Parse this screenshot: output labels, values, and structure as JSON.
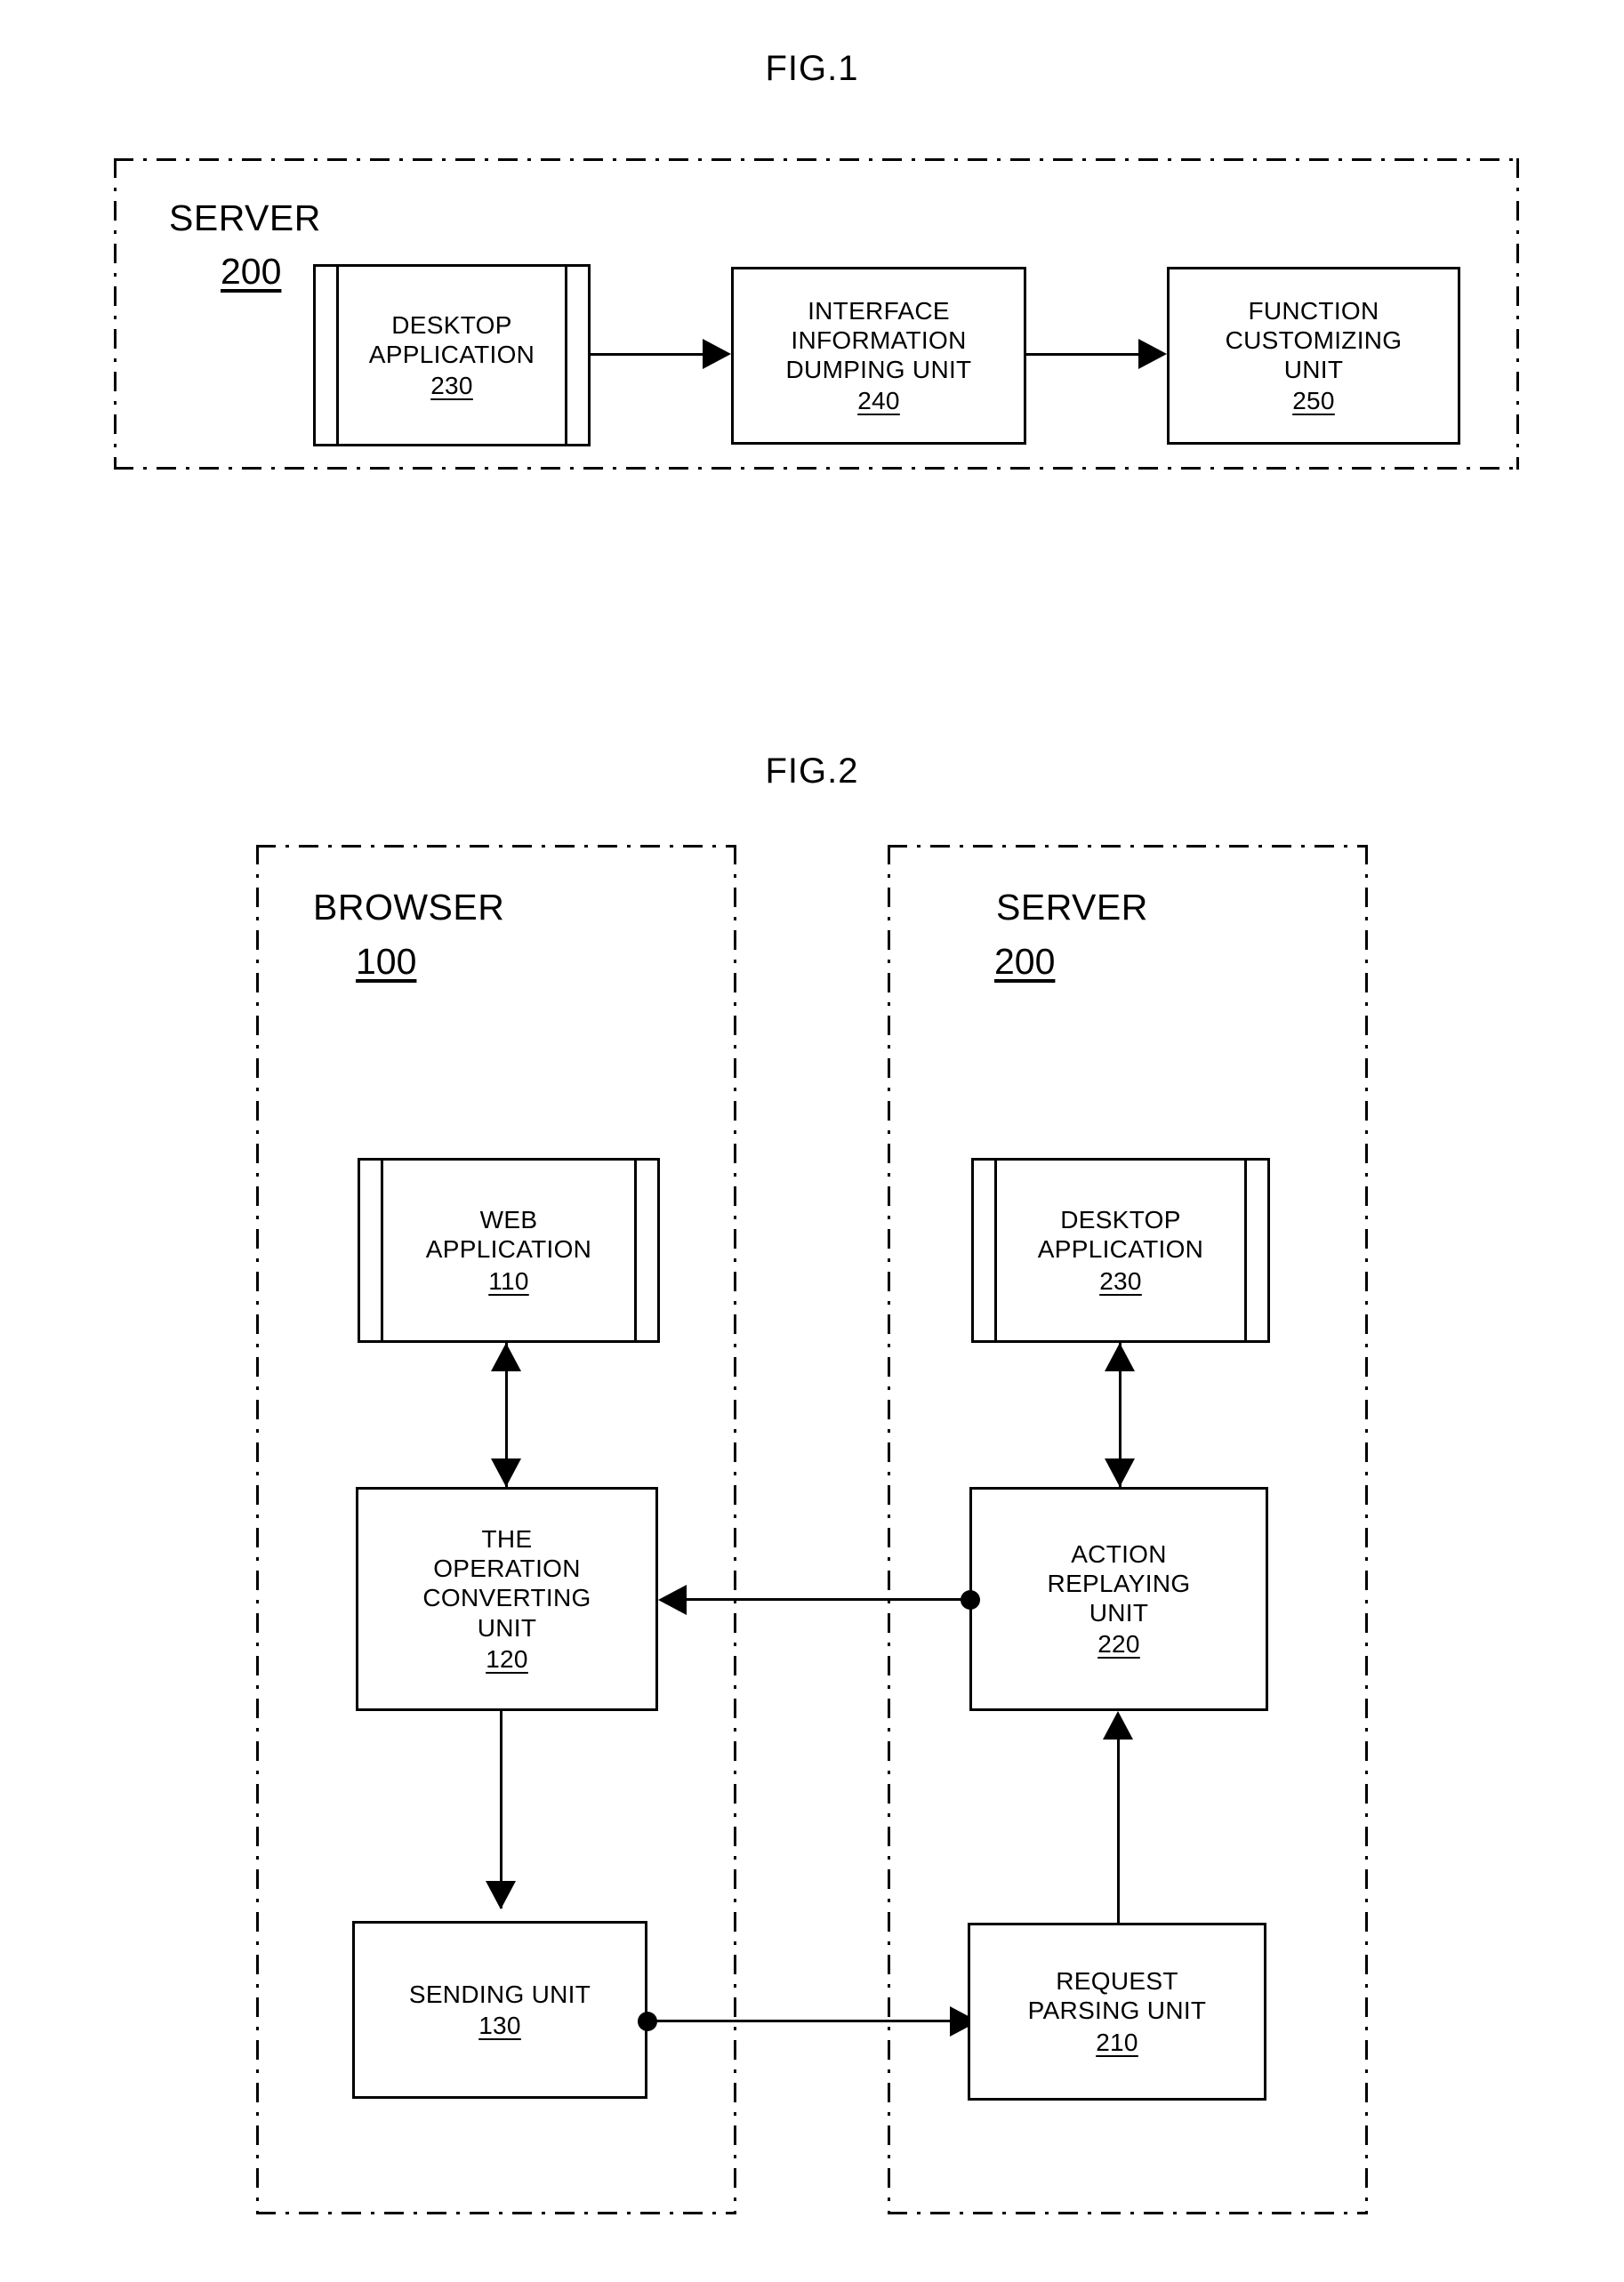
{
  "figures": [
    {
      "title": "FIG.1",
      "container": {
        "label": "SERVER",
        "number": "200"
      },
      "boxes": [
        {
          "id": "desktop-application-230",
          "lines": "DESKTOP\nAPPLICATION",
          "number": "230",
          "style": "predefined-process"
        },
        {
          "id": "interface-information-dumping-unit-240",
          "lines": "INTERFACE\nINFORMATION\nDUMPING UNIT",
          "number": "240",
          "style": "process"
        },
        {
          "id": "function-customizing-unit-250",
          "lines": "FUNCTION\nCUSTOMIZING\nUNIT",
          "number": "250",
          "style": "process"
        }
      ],
      "connectors": [
        {
          "from": "desktop-application-230",
          "to": "interface-information-dumping-unit-240",
          "kind": "arrow-right"
        },
        {
          "from": "interface-information-dumping-unit-240",
          "to": "function-customizing-unit-250",
          "kind": "arrow-right"
        }
      ]
    },
    {
      "title": "FIG.2",
      "containers": [
        {
          "label": "BROWSER",
          "number": "100"
        },
        {
          "label": "SERVER",
          "number": "200"
        }
      ],
      "boxes": [
        {
          "id": "web-application-110",
          "lines": "WEB\nAPPLICATION",
          "number": "110",
          "style": "predefined-process"
        },
        {
          "id": "the-operation-converting-unit-120",
          "lines": "THE\nOPERATION\nCONVERTING\nUNIT",
          "number": "120",
          "style": "process"
        },
        {
          "id": "sending-unit-130",
          "lines": "SENDING UNIT",
          "number": "130",
          "style": "process"
        },
        {
          "id": "desktop-application-230",
          "lines": "DESKTOP\nAPPLICATION",
          "number": "230",
          "style": "predefined-process"
        },
        {
          "id": "action-replaying-unit-220",
          "lines": "ACTION\nREPLAYING\nUNIT",
          "number": "220",
          "style": "process"
        },
        {
          "id": "request-parsing-unit-210",
          "lines": "REQUEST\nPARSING UNIT",
          "number": "210",
          "style": "process"
        }
      ],
      "connectors": [
        {
          "from": "web-application-110",
          "to": "the-operation-converting-unit-120",
          "kind": "double-arrow-vertical"
        },
        {
          "from": "the-operation-converting-unit-120",
          "to": "sending-unit-130",
          "kind": "arrow-down"
        },
        {
          "from": "sending-unit-130",
          "to": "request-parsing-unit-210",
          "kind": "arrow-right"
        },
        {
          "from": "request-parsing-unit-210",
          "to": "action-replaying-unit-220",
          "kind": "arrow-up"
        },
        {
          "from": "action-replaying-unit-220",
          "to": "desktop-application-230",
          "kind": "double-arrow-vertical"
        },
        {
          "from": "action-replaying-unit-220",
          "to": "the-operation-converting-unit-120",
          "kind": "arrow-left"
        }
      ]
    }
  ]
}
